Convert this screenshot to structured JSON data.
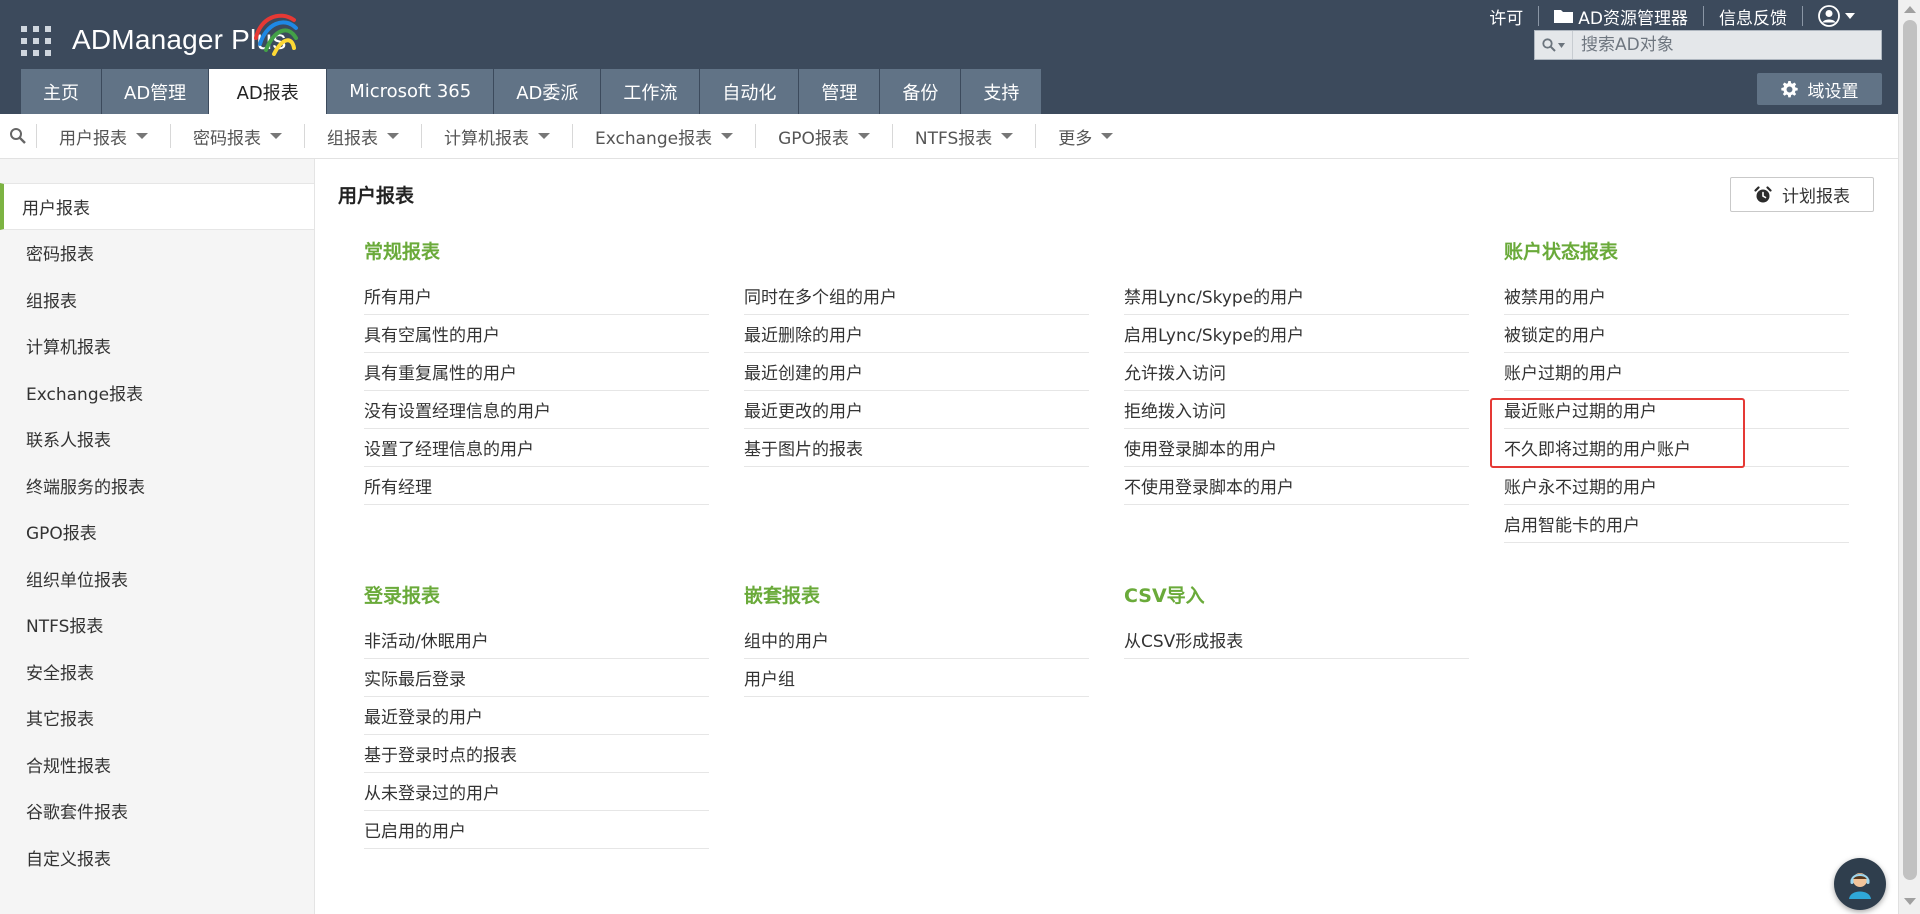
{
  "header": {
    "app_name": "ADManager Plus",
    "top_links": {
      "license": "许可",
      "ad_explorer": "AD资源管理器",
      "feedback": "信息反馈"
    },
    "search_placeholder": "搜索AD对象",
    "domain_settings": "域设置",
    "tabs": [
      {
        "label": "主页"
      },
      {
        "label": "AD管理"
      },
      {
        "label": "AD报表",
        "active": true
      },
      {
        "label": "Microsoft 365"
      },
      {
        "label": "AD委派"
      },
      {
        "label": "工作流"
      },
      {
        "label": "自动化"
      },
      {
        "label": "管理"
      },
      {
        "label": "备份"
      },
      {
        "label": "支持"
      }
    ]
  },
  "subnav": {
    "items": [
      {
        "label": "用户报表"
      },
      {
        "label": "密码报表"
      },
      {
        "label": "组报表"
      },
      {
        "label": "计算机报表"
      },
      {
        "label": "Exchange报表"
      },
      {
        "label": "GPO报表"
      },
      {
        "label": "NTFS报表"
      },
      {
        "label": "更多"
      }
    ]
  },
  "sidebar": {
    "items": [
      {
        "label": "用户报表",
        "active": true
      },
      {
        "label": "密码报表"
      },
      {
        "label": "组报表"
      },
      {
        "label": "计算机报表"
      },
      {
        "label": "Exchange报表"
      },
      {
        "label": "联系人报表"
      },
      {
        "label": "终端服务的报表"
      },
      {
        "label": "GPO报表"
      },
      {
        "label": "组织单位报表"
      },
      {
        "label": "NTFS报表"
      },
      {
        "label": "安全报表"
      },
      {
        "label": "其它报表"
      },
      {
        "label": "合规性报表"
      },
      {
        "label": "谷歌套件报表"
      },
      {
        "label": "自定义报表"
      }
    ]
  },
  "main": {
    "title": "用户报表",
    "schedule_button": "计划报表",
    "sections": {
      "general": {
        "title": "常规报表",
        "col1": [
          "所有用户",
          "具有空属性的用户",
          "具有重复属性的用户",
          "没有设置经理信息的用户",
          "设置了经理信息的用户",
          "所有经理"
        ],
        "col2": [
          "同时在多个组的用户",
          "最近删除的用户",
          "最近创建的用户",
          "最近更改的用户",
          "基于图片的报表"
        ],
        "col3": [
          "禁用Lync/Skype的用户",
          "启用Lync/Skype的用户",
          "允许拨入访问",
          "拒绝拨入访问",
          "使用登录脚本的用户",
          "不使用登录脚本的用户"
        ]
      },
      "account_status": {
        "title": "账户状态报表",
        "items": [
          "被禁用的用户",
          "被锁定的用户",
          "账户过期的用户",
          "最近账户过期的用户",
          "不久即将过期的用户账户",
          "账户永不过期的用户",
          "启用智能卡的用户"
        ]
      },
      "logon": {
        "title": "登录报表",
        "items": [
          "非活动/休眠用户",
          "实际最后登录",
          "最近登录的用户",
          "基于登录时点的报表",
          "从未登录过的用户",
          "已启用的用户"
        ]
      },
      "nested": {
        "title": "嵌套报表",
        "items": [
          "组中的用户",
          "用户组"
        ]
      },
      "csv": {
        "title": "CSV导入",
        "items": [
          "从CSV形成报表"
        ]
      }
    }
  },
  "colors": {
    "header_bg": "#3c4a5c",
    "tab_bg": "#617386",
    "section_title": "#6aaa3a",
    "highlight": "#e53935"
  }
}
